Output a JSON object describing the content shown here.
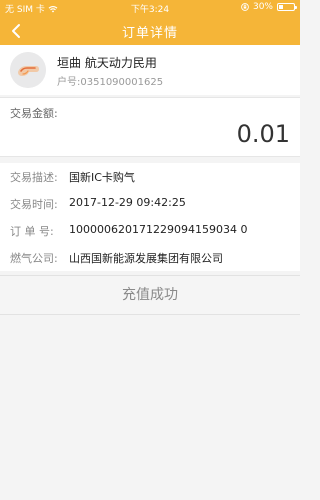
{
  "status_bar": {
    "carrier": "无 SIM 卡",
    "time": "下午3:24",
    "battery_percent": "30%",
    "battery_level": 0.3
  },
  "header": {
    "title": "订单详情"
  },
  "account": {
    "name": "垣曲 航天动力民用",
    "number": "户号:0351090001625"
  },
  "transaction": {
    "amount_label": "交易金额:",
    "amount_value": "0.01"
  },
  "details": [
    {
      "label": "交易描述:",
      "value": "国新IC卡购气"
    },
    {
      "label": "交易时间:",
      "value": "2017-12-29 09:42:25"
    },
    {
      "label": "订 单 号:",
      "value": "100000620171229094159034 0"
    },
    {
      "label": "燃气公司:",
      "value": "山西国新能源发展集团有限公司"
    }
  ],
  "status_button": {
    "label": "充值成功"
  },
  "colors": {
    "accent": "#f5b538"
  }
}
